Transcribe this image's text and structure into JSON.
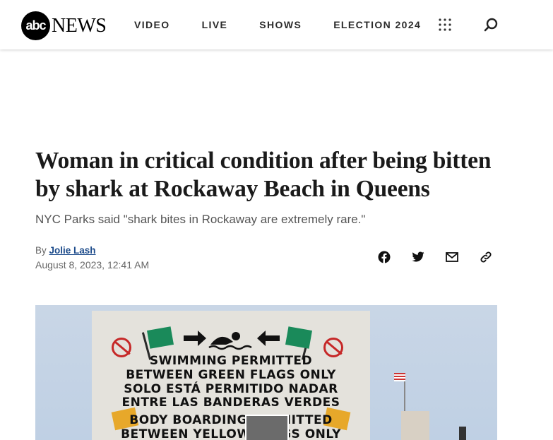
{
  "header": {
    "logo_abc": "abc",
    "logo_news": "NEWS",
    "nav": [
      "VIDEO",
      "LIVE",
      "SHOWS",
      "ELECTION 2024"
    ]
  },
  "article": {
    "headline": "Woman in critical condition after being bitten by shark at Rockaway Beach in Queens",
    "subheadline": "NYC Parks said \"shark bites in Rockaway are extremely rare.\"",
    "byline_prefix": "By",
    "author": "Jolie Lash",
    "timestamp": "August 8, 2023, 12:41 AM"
  },
  "share_icons": [
    "facebook-icon",
    "twitter-icon",
    "mail-icon",
    "link-icon"
  ],
  "hero_sign": {
    "lines": [
      "SWIMMING PERMITTED",
      "BETWEEN GREEN FLAGS ONLY",
      "SOLO ESTÁ PERMITIDO NADAR",
      "ENTRE LAS BANDERAS VERDES",
      "BODY BOARDING PERMITTED",
      "BETWEEN YELLOW FLAGS ONLY"
    ]
  },
  "colors": {
    "author_link": "#1b4a8a",
    "green_flag": "#1a8a5a",
    "yellow_flag": "#e7a82a",
    "no_swim_red": "#c62828"
  }
}
